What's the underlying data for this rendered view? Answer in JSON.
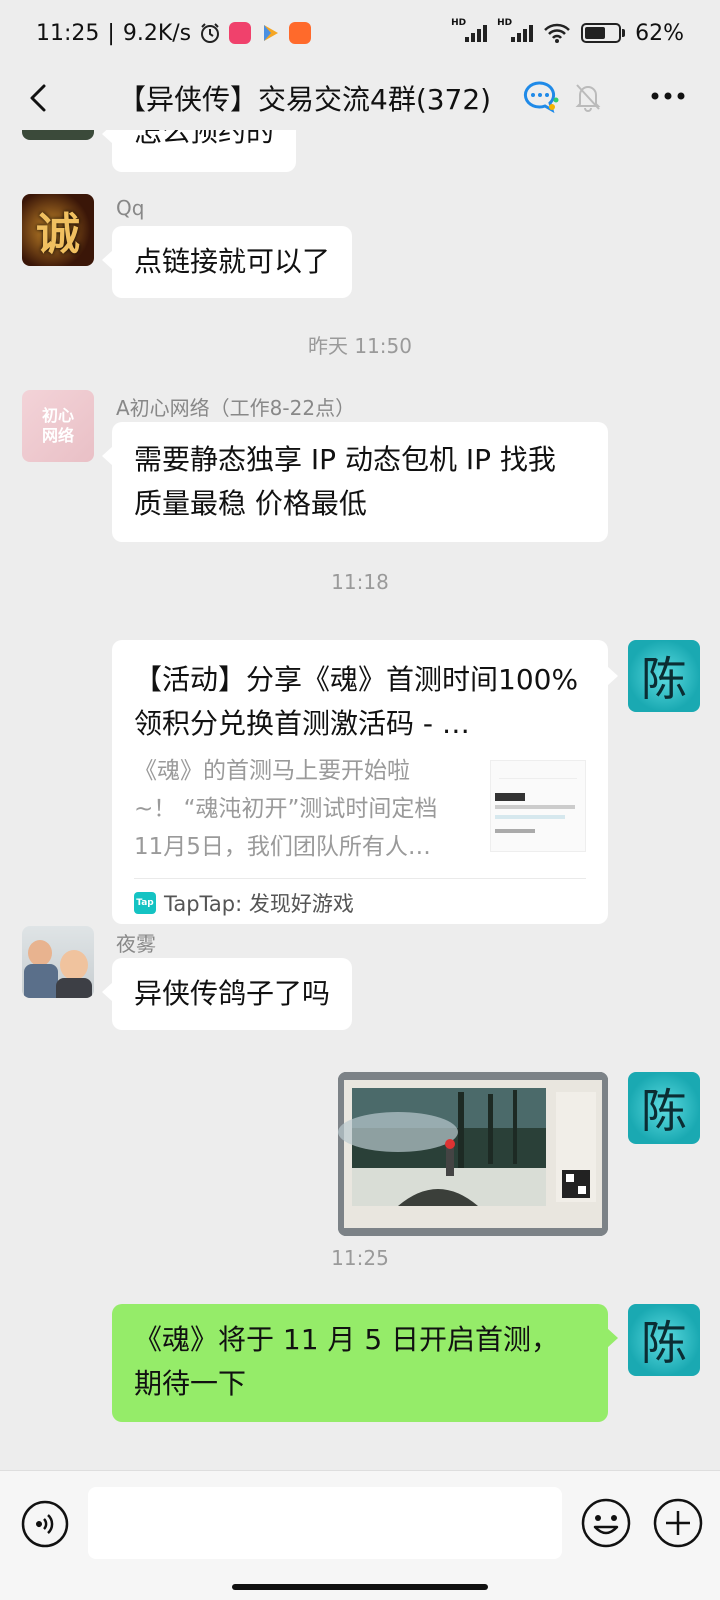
{
  "status_bar": {
    "time": "11:25",
    "net_speed": "9.2K/s",
    "battery": "62%",
    "battery_level": 0.62,
    "signal_1_label": "HD",
    "signal_2_label": "HD"
  },
  "header": {
    "title": "【异侠传】交易交流4群(372)",
    "icons": [
      "back-arrow-icon",
      "group-chat-icon",
      "mute-bell-icon",
      "more-dots-icon"
    ]
  },
  "messages": {
    "m0": {
      "text": "怎么预约的"
    },
    "m1": {
      "sender": "Qq",
      "avatar_text": "诚",
      "text": "点链接就可以了"
    },
    "ts1": "昨天 11:50",
    "m2": {
      "sender": "A初心网络（工作8-22点）",
      "avatar_text": "初心网络",
      "text": "需要静态独享 IP  动态包机 IP  找我   质量最稳 价格最低"
    },
    "ts2": "11:18",
    "m3": {
      "avatar_text": "陈",
      "card_title": "【活动】分享《魂》首测时间100%领积分兑换首测激活码 - …",
      "card_desc": "《魂》的首测马上要开始啦~！ “魂沌初开”测试时间定档11月5日，我们团队所有人…",
      "source_logo": "Tap",
      "source": "TapTap: 发现好游戏"
    },
    "m4": {
      "sender": "夜雾",
      "text": "异侠传鸽子了吗"
    },
    "m5": {
      "avatar_text": "陈",
      "image": "game-screenshot"
    },
    "ts3": "11:25",
    "m6": {
      "avatar_text": "陈",
      "text": "《魂》将于 11 月 5 日开启首测，期待一下"
    }
  },
  "input_bar": {
    "value": "",
    "icons": [
      "voice-icon",
      "emoji-icon",
      "plus-icon"
    ]
  },
  "colors": {
    "background": "#ededed",
    "self_bubble": "#95ec69",
    "other_bubble": "#ffffff",
    "timestamp": "#9a9a9a"
  }
}
